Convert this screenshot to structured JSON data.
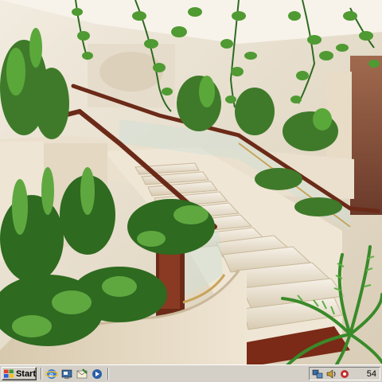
{
  "desktop": {
    "wallpaper": "atrium-staircase-with-plants-icon"
  },
  "taskbar": {
    "start_label": "Start",
    "quick_launch": [
      {
        "name": "internet-explorer-icon"
      },
      {
        "name": "show-desktop-icon"
      },
      {
        "name": "outlook-express-icon"
      },
      {
        "name": "media-player-icon"
      }
    ],
    "tray_icons": [
      {
        "name": "network-icon"
      },
      {
        "name": "volume-icon"
      }
    ],
    "clock": "54"
  },
  "colors": {
    "taskbar": "#d4d0c8",
    "handrail": "#6b2a18",
    "marble": "#e8dcc8",
    "foliage": "#3f7a2a"
  }
}
